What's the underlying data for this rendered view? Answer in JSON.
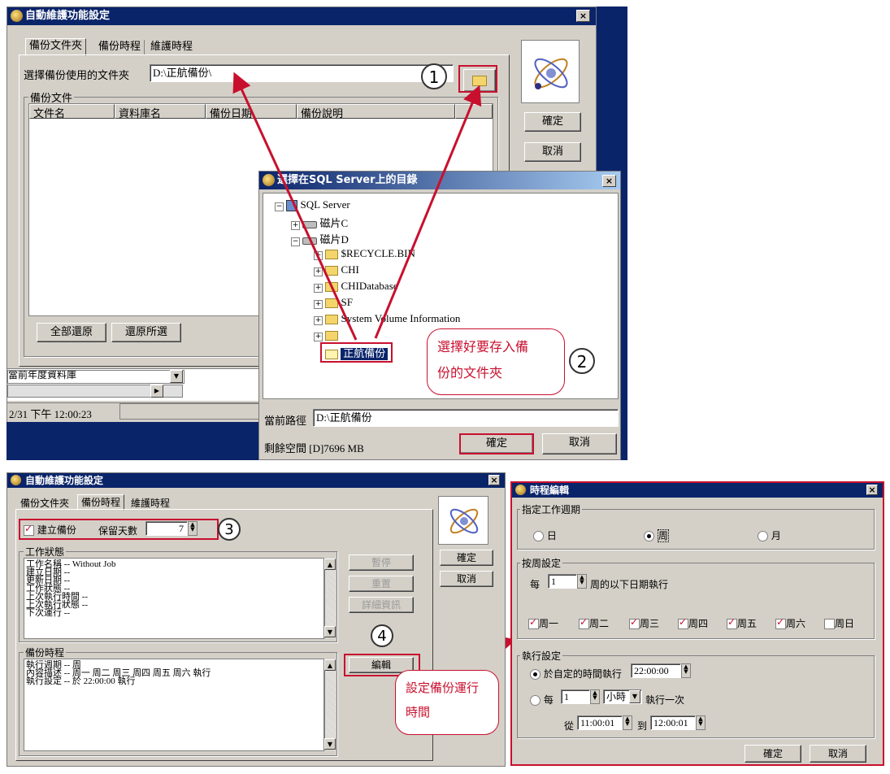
{
  "top": {
    "main_window": {
      "title": "自動維護功能設定",
      "close_label": "×",
      "tabs": [
        "備份文件夾",
        "備份時程",
        "維護時程"
      ],
      "folder_label": "選擇備份使用的文件夾",
      "folder_value": "D:\\正航備份\\",
      "group_label": "備份文件",
      "columns": [
        "文件名",
        "資料庫名",
        "備份日期",
        "備份說明"
      ],
      "btn_restore_all": "全部還原",
      "btn_restore_selected": "還原所選",
      "ok": "確定",
      "cancel": "取消",
      "combo_value": "當前年度資料庫",
      "status_time": "2/31 下午 12:00:23"
    },
    "dialog": {
      "title": "選擇在SQL Server上的目錄",
      "close_label": "×",
      "tree": [
        {
          "label": "SQL Server",
          "expander": "−"
        },
        {
          "label": "磁片C",
          "expander": "+"
        },
        {
          "label": "磁片D",
          "expander": "−"
        },
        {
          "label": "$RECYCLE.BIN",
          "expander": "+"
        },
        {
          "label": "CHI",
          "expander": "+"
        },
        {
          "label": "CHIDatabase",
          "expander": "+"
        },
        {
          "label": "SF",
          "expander": "+"
        },
        {
          "label": "System Volume Information",
          "expander": "+"
        },
        {
          "label": "",
          "expander": "+"
        },
        {
          "label": "正航備份",
          "expander": ""
        }
      ],
      "path_label": "當前路徑",
      "path_value": "D:\\正航備份",
      "free_space": "剩餘空間 [D]7696 MB",
      "ok": "確定",
      "cancel": "取消"
    },
    "step1": "1",
    "step2": "2",
    "callout": [
      "選擇好要存入備",
      "份的文件夾"
    ]
  },
  "bottom": {
    "main_window": {
      "title": "自動維護功能設定",
      "close_label": "×",
      "tabs": [
        "備份文件夾",
        "備份時程",
        "維護時程"
      ],
      "create_backup": "建立備份",
      "keep_days_label": "保留天數",
      "keep_days_value": "7",
      "status_group": "工作狀態",
      "status_lines": [
        "工作名稱 -- Without Job",
        "建立日期 --",
        "更新日期 --",
        "工作狀態 --",
        "上次執行時間 --",
        "上次執行狀態 --",
        "下次運行 --"
      ],
      "btn_pause": "暫停",
      "btn_reset": "重置",
      "btn_details": "詳細資訊",
      "schedule_group": "備份時程",
      "schedule_lines": [
        "執行週期 -- 周",
        "內容描述 -- 周一 周二 周三 周四 周五 周六  執行",
        "執行設定 -- 於 22:00:00 執行"
      ],
      "btn_edit": "編輯",
      "ok": "確定",
      "cancel": "取消"
    },
    "schedule_dialog": {
      "title": "時程編輯",
      "close_label": "×",
      "period_group": "指定工作週期",
      "periods": [
        "日",
        "周",
        "月"
      ],
      "weekly_group": "按周設定",
      "every": "每",
      "every_value": "1",
      "weekly_suffix": "周的以下日期執行",
      "days": [
        {
          "label": "周一",
          "checked": true
        },
        {
          "label": "周二",
          "checked": true
        },
        {
          "label": "周三",
          "checked": true
        },
        {
          "label": "周四",
          "checked": true
        },
        {
          "label": "周五",
          "checked": true
        },
        {
          "label": "周六",
          "checked": true
        },
        {
          "label": "周日",
          "checked": false
        }
      ],
      "exec_group": "執行設定",
      "at_time_label": "於自定的時間執行",
      "at_time_value": "22:00:00",
      "every2": "每",
      "every2_value": "1",
      "unit": "小時",
      "every_suffix": "執行一次",
      "from_label": "從",
      "from_value": "11:00:01",
      "to_label": "到",
      "to_value": "12:00:01",
      "ok": "確定",
      "cancel": "取消"
    },
    "step3": "3",
    "step4": "4",
    "callout": [
      "設定備份運行",
      "時間"
    ]
  }
}
